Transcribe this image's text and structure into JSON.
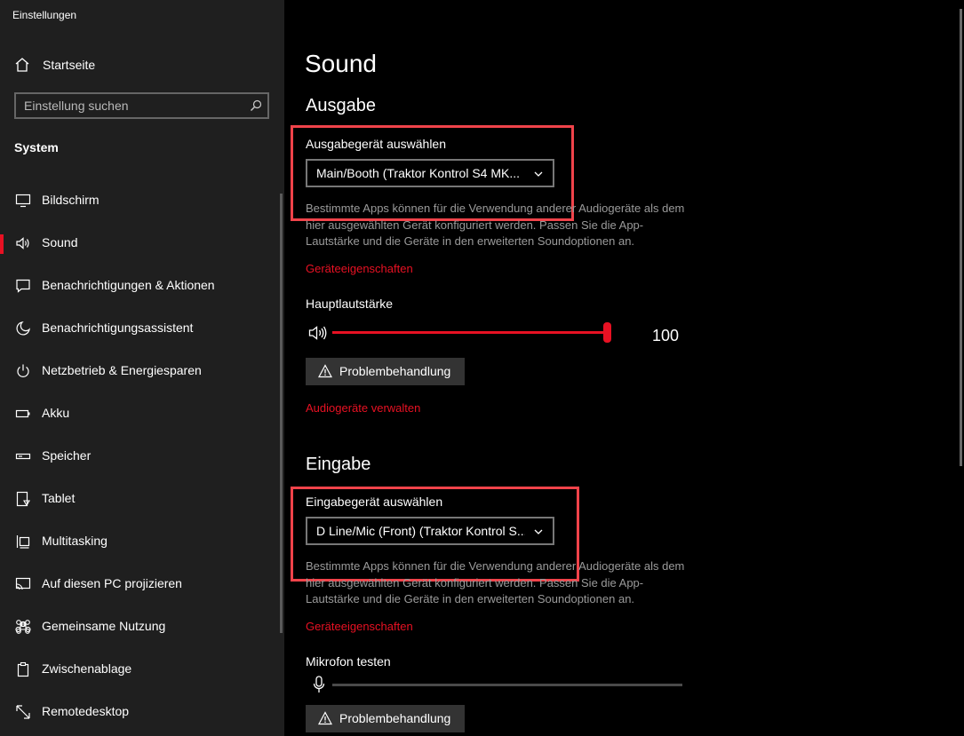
{
  "window": {
    "title": "Einstellungen",
    "controls": {
      "minimize": "—",
      "maximize": "☐",
      "close": "✕"
    }
  },
  "sidebar": {
    "home_label": "Startseite",
    "search_placeholder": "Einstellung suchen",
    "section_label": "System",
    "items": [
      {
        "label": "Bildschirm",
        "icon": "monitor-icon"
      },
      {
        "label": "Sound",
        "icon": "speaker-icon",
        "selected": true
      },
      {
        "label": "Benachrichtigungen & Aktionen",
        "icon": "notification-icon"
      },
      {
        "label": "Benachrichtigungsassistent",
        "icon": "moon-icon"
      },
      {
        "label": "Netzbetrieb & Energiesparen",
        "icon": "power-icon"
      },
      {
        "label": "Akku",
        "icon": "battery-icon"
      },
      {
        "label": "Speicher",
        "icon": "storage-icon"
      },
      {
        "label": "Tablet",
        "icon": "tablet-icon"
      },
      {
        "label": "Multitasking",
        "icon": "multitasking-icon"
      },
      {
        "label": "Auf diesen PC projizieren",
        "icon": "project-icon"
      },
      {
        "label": "Gemeinsame Nutzung",
        "icon": "shared-experiences-icon"
      },
      {
        "label": "Zwischenablage",
        "icon": "clipboard-icon"
      },
      {
        "label": "Remotedesktop",
        "icon": "remote-desktop-icon"
      }
    ]
  },
  "main": {
    "page_title": "Sound",
    "output": {
      "heading": "Ausgabe",
      "device_label": "Ausgabegerät auswählen",
      "device_value": "Main/Booth (Traktor Kontrol S4 MK...",
      "description": "Bestimmte Apps können für die Verwendung anderer Audiogeräte als dem hier ausgewählten Gerät konfiguriert werden. Passen Sie die App-Lautstärke und die Geräte in den erweiterten Soundoptionen an.",
      "properties_link": "Geräteeigenschaften",
      "volume_label": "Hauptlautstärke",
      "volume_value": "100",
      "volume_level": 1.0,
      "troubleshoot_label": "Problembehandlung",
      "manage_link": "Audiogeräte verwalten"
    },
    "input": {
      "heading": "Eingabe",
      "device_label": "Eingabegerät auswählen",
      "device_value": "D Line/Mic (Front) (Traktor Kontrol S...",
      "description": "Bestimmte Apps können für die Verwendung anderer Audiogeräte als dem hier ausgewählten Gerät konfiguriert werden. Passen Sie die App-Lautstärke und die Geräte in den erweiterten Soundoptionen an.",
      "properties_link": "Geräteeigenschaften",
      "mic_label": "Mikrofon testen",
      "mic_level": 0.0,
      "troubleshoot_label": "Problembehandlung"
    }
  },
  "colors": {
    "accent": "#e81123",
    "highlight_box": "#f0434a",
    "sidebar_bg": "#1f1f1f",
    "main_bg": "#000000"
  }
}
